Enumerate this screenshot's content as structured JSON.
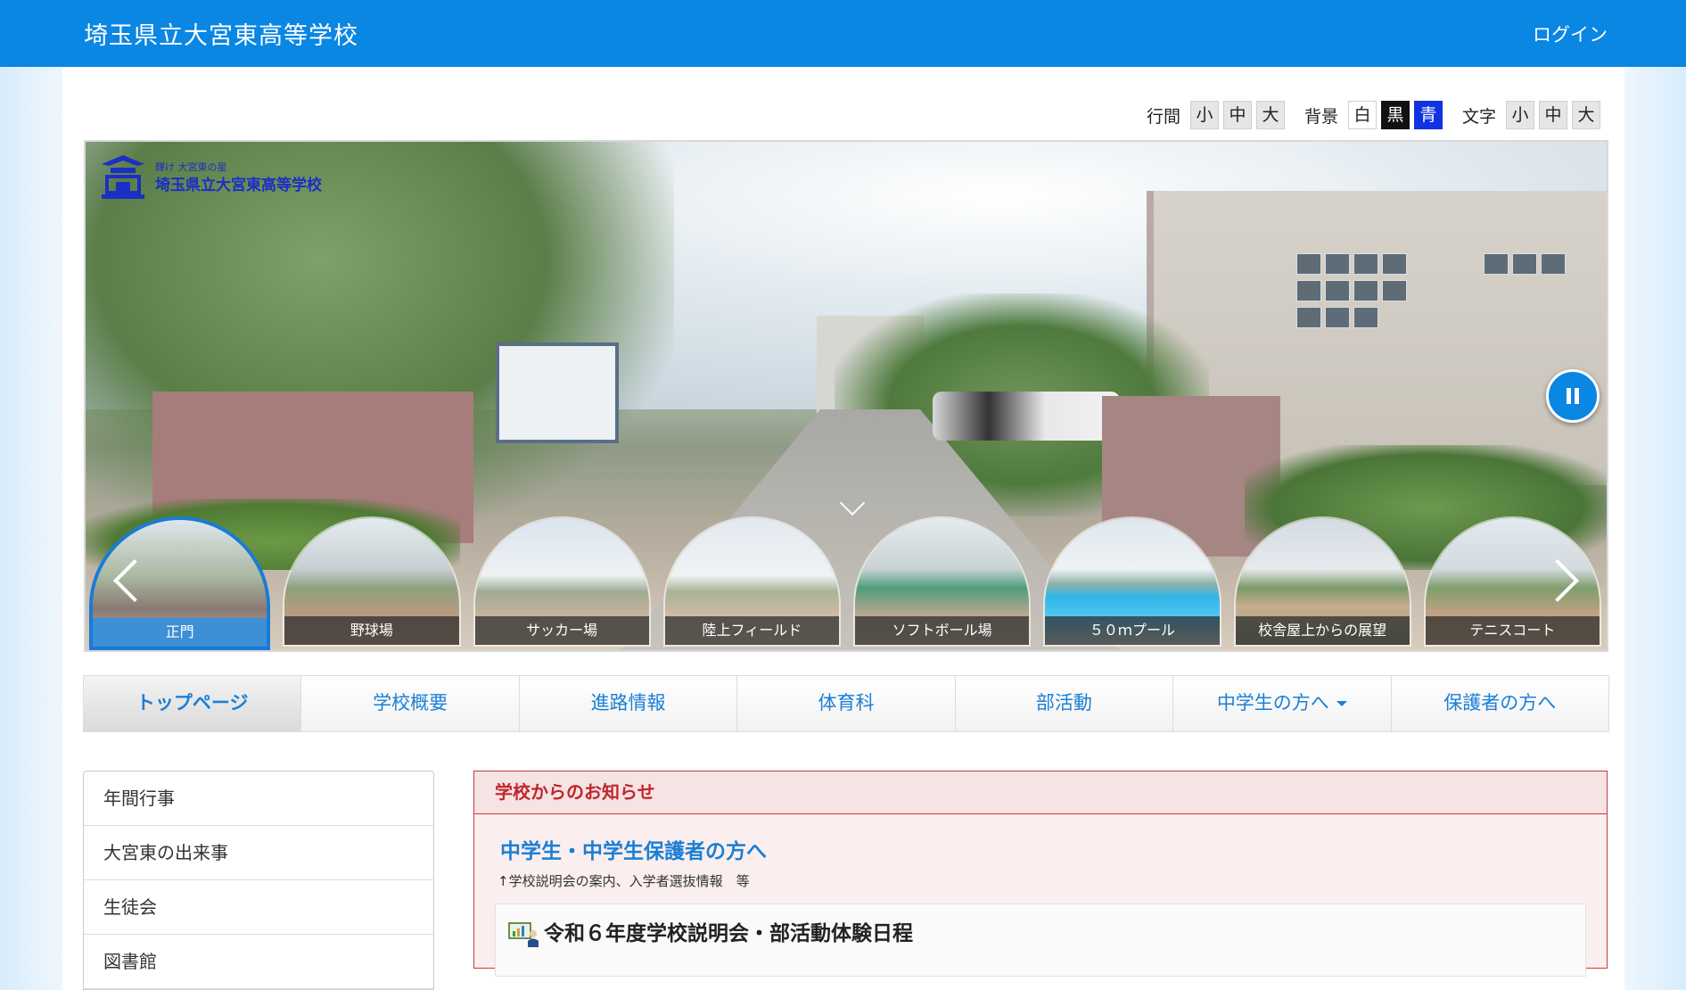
{
  "header": {
    "site_title": "埼玉県立大宮東高等学校",
    "login_label": "ログイン"
  },
  "a11y": {
    "line_spacing_label": "行間",
    "background_label": "背景",
    "text_label": "文字",
    "size_small": "小",
    "size_medium": "中",
    "size_large": "大",
    "bg_white": "白",
    "bg_black": "黒",
    "bg_blue": "青"
  },
  "hero": {
    "logo_sub": "輝け 大宮東の星",
    "logo_name": "埼玉県立大宮東高等学校",
    "thumbnails": [
      "正門",
      "野球場",
      "サッカー場",
      "陸上フィールド",
      "ソフトボール場",
      "５０ｍプール",
      "校舎屋上からの展望",
      "テニスコート"
    ],
    "active_thumbnail": "正門"
  },
  "nav": {
    "items": [
      "トップページ",
      "学校概要",
      "進路情報",
      "体育科",
      "部活動",
      "中学生の方へ",
      "保護者の方へ"
    ]
  },
  "sidebar": {
    "items": [
      "年間行事",
      "大宮東の出来事",
      "生徒会",
      "図書館"
    ]
  },
  "news": {
    "header": "学校からのお知らせ",
    "heading": "中学生・中学生保護者の方へ",
    "subtext": "↑学校説明会の案内、入学者選抜情報　等",
    "card_title": "令和６年度学校説明会・部活動体験日程"
  },
  "colors": {
    "brand": "#0a86e3",
    "link": "#1a7fd6",
    "notice_red": "#c0262c"
  }
}
